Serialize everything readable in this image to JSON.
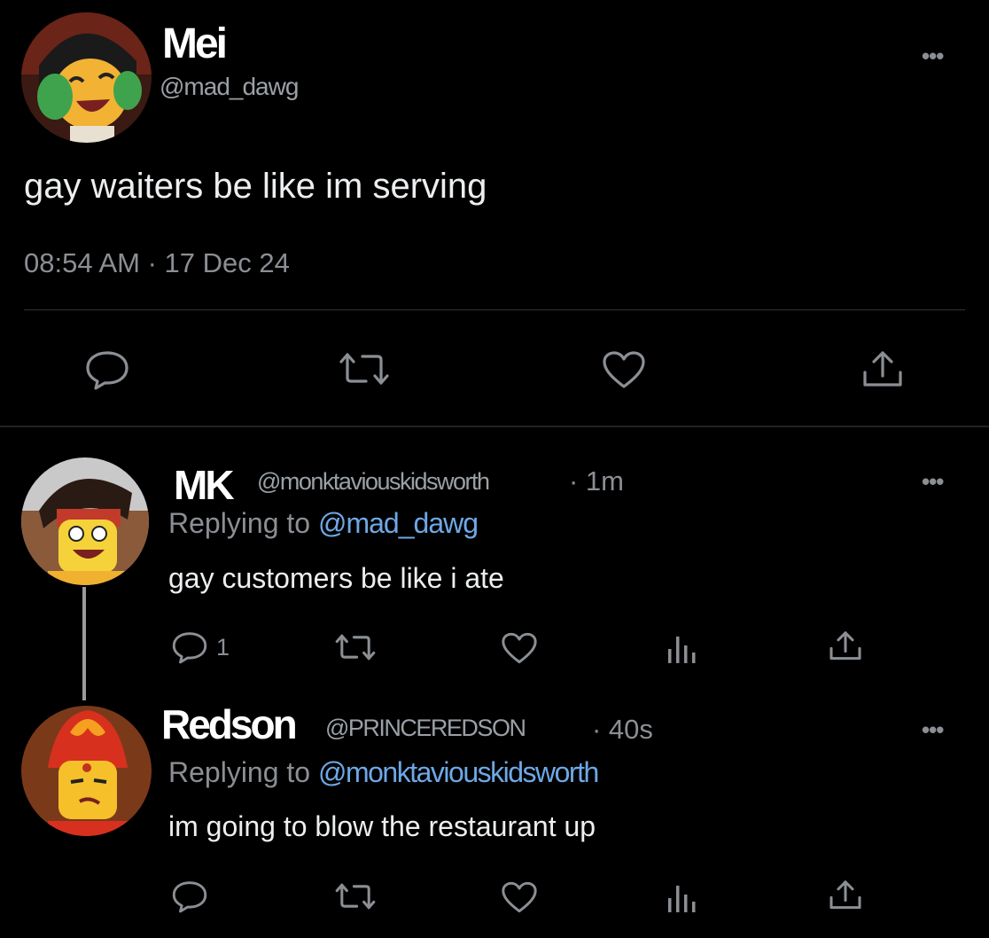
{
  "main_tweet": {
    "display_name": "Mei",
    "handle": "@mad_dawg",
    "text": "gay waiters be like im serving",
    "timestamp": "08:54 AM · 17 Dec 24",
    "more_label": "•••"
  },
  "replies": [
    {
      "display_name": "MK",
      "handle": "@monktaviouskidsworth",
      "age": "· 1m",
      "replying_prefix": "Replying to",
      "replying_to": "@mad_dawg",
      "text": "gay customers be like i ate",
      "reply_count": "1",
      "more_label": "•••"
    },
    {
      "display_name": "Redson",
      "handle": "@PRINCEREDSON",
      "age": "· 40s",
      "replying_prefix": "Replying to",
      "replying_to": "@monktaviouskidsworth",
      "text": "im going to blow the restaurant up",
      "reply_count": "",
      "more_label": "•••"
    }
  ],
  "icons": {
    "reply": "reply-icon",
    "retweet": "retweet-icon",
    "like": "heart-icon",
    "views": "views-icon",
    "share": "share-icon"
  },
  "colors": {
    "background": "#000000",
    "link": "#6ea8e6",
    "muted": "#8b8f94",
    "divider": "#2f3336"
  }
}
